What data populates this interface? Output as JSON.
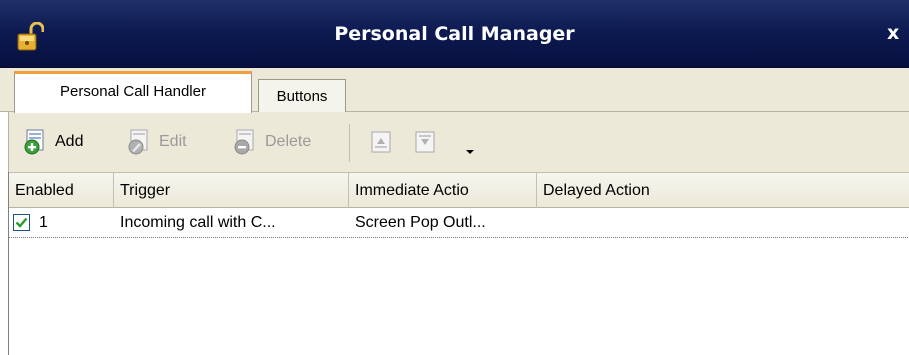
{
  "window": {
    "title": "Personal Call Manager",
    "close_glyph": "x"
  },
  "icons": {
    "lock": "lock-open-icon",
    "add": "add-document-icon",
    "edit": "edit-document-icon",
    "delete": "delete-document-icon",
    "move_up": "move-up-icon",
    "move_down": "move-down-icon",
    "dropdown": "chevron-down-icon"
  },
  "tabs": [
    {
      "label": "Personal Call Handler",
      "selected": true
    },
    {
      "label": "Buttons",
      "selected": false
    }
  ],
  "toolbar": {
    "add_label": "Add",
    "edit_label": "Edit",
    "delete_label": "Delete",
    "edit_enabled": false,
    "delete_enabled": false
  },
  "grid": {
    "columns": [
      "Enabled",
      "Trigger",
      "Immediate Actio",
      "Delayed Action"
    ],
    "rows": [
      {
        "enabled": true,
        "number": "1",
        "trigger": "Incoming call with C...",
        "immediate_action": "Screen Pop Outl...",
        "delayed_action": ""
      }
    ]
  },
  "colors": {
    "titlebar": "#0d1b52",
    "tab_accent": "#f0a040",
    "chrome": "#ece9d8",
    "checkbox_check": "#2a9a2a"
  }
}
